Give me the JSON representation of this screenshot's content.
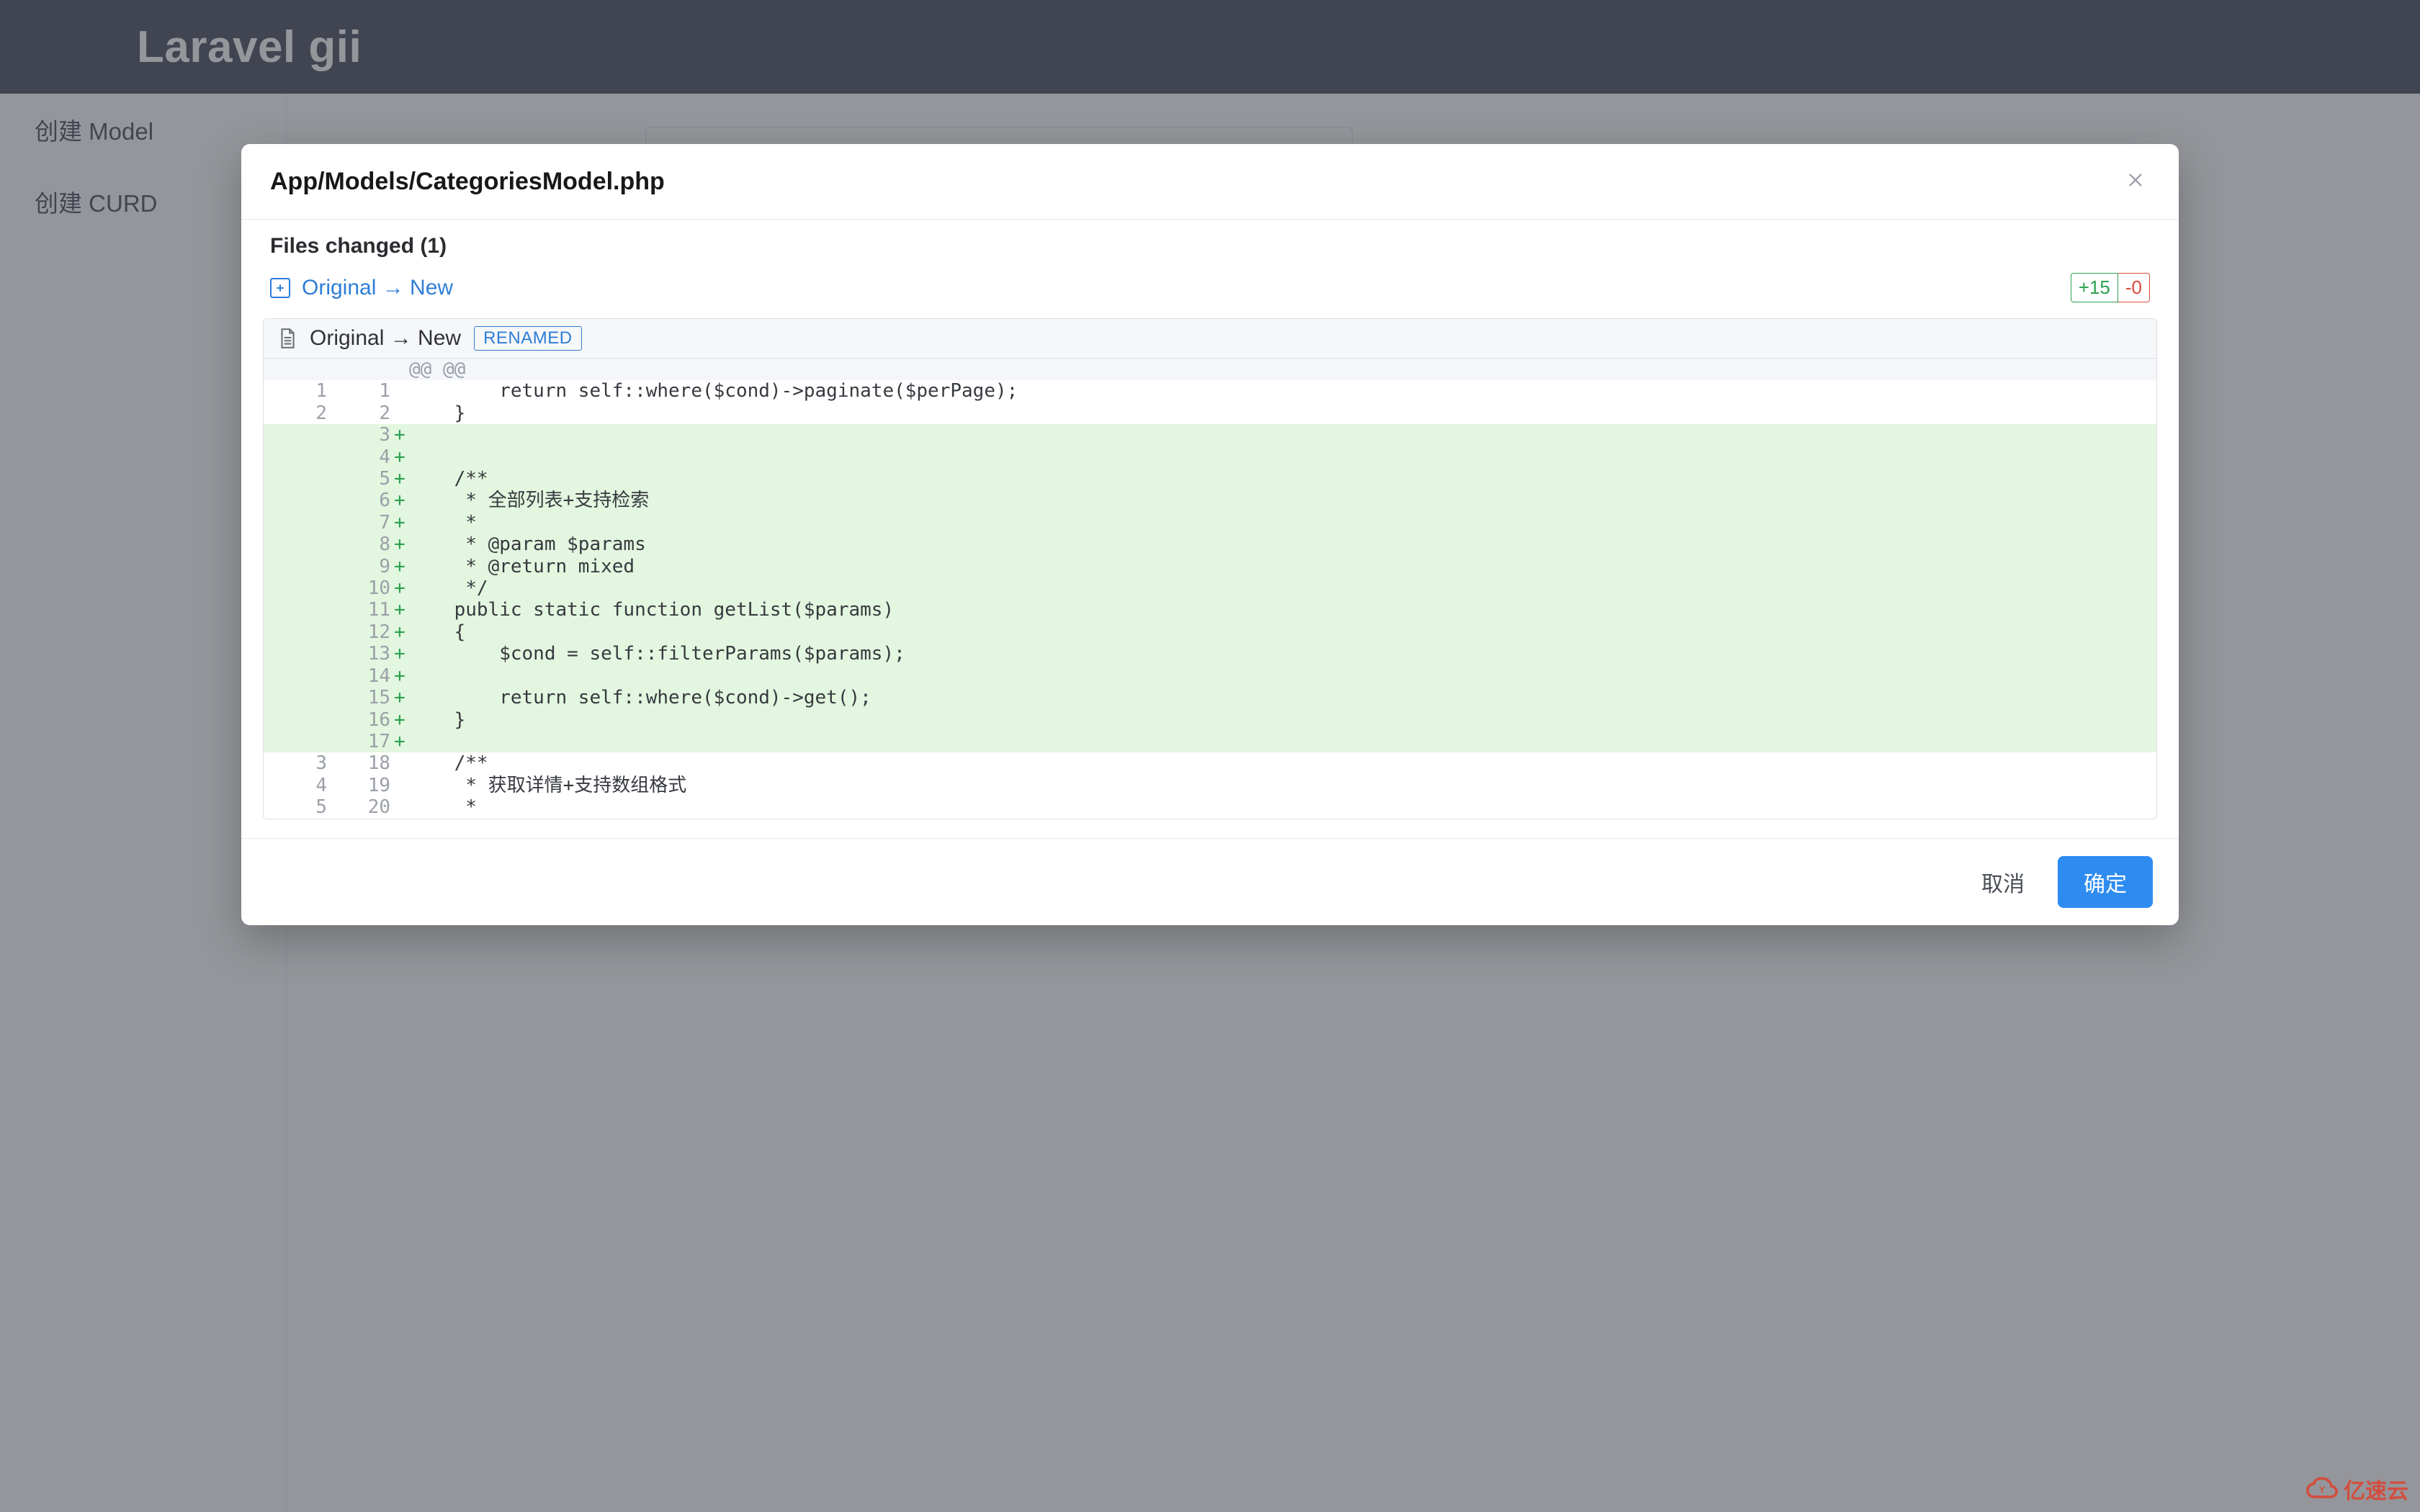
{
  "header": {
    "brand": "Laravel gii"
  },
  "sidebar": {
    "items": [
      {
        "label": "创建 Model"
      },
      {
        "label": "创建 CURD"
      }
    ]
  },
  "modal": {
    "title": "App/Models/CategoriesModel.php",
    "files_changed_label": "Files changed (1)",
    "file_link_label": "Original → New",
    "stats": {
      "additions": "+15",
      "deletions": "-0"
    },
    "diff_header_label": "Original → New",
    "renamed_badge": "RENAMED",
    "footer": {
      "cancel": "取消",
      "confirm": "确定"
    }
  },
  "diff": {
    "hunk_header": "@@ @@",
    "rows": [
      {
        "old": "1",
        "new": "1",
        "marker": " ",
        "code": "        return self::where($cond)->paginate($perPage);",
        "type": "ctx"
      },
      {
        "old": "2",
        "new": "2",
        "marker": " ",
        "code": "    }",
        "type": "ctx"
      },
      {
        "old": "",
        "new": "3",
        "marker": "+",
        "code": "",
        "type": "add"
      },
      {
        "old": "",
        "new": "4",
        "marker": "+",
        "code": "",
        "type": "add"
      },
      {
        "old": "",
        "new": "5",
        "marker": "+",
        "code": "    /**",
        "type": "add"
      },
      {
        "old": "",
        "new": "6",
        "marker": "+",
        "code": "     * 全部列表+支持检索",
        "type": "add"
      },
      {
        "old": "",
        "new": "7",
        "marker": "+",
        "code": "     *",
        "type": "add"
      },
      {
        "old": "",
        "new": "8",
        "marker": "+",
        "code": "     * @param $params",
        "type": "add"
      },
      {
        "old": "",
        "new": "9",
        "marker": "+",
        "code": "     * @return mixed",
        "type": "add"
      },
      {
        "old": "",
        "new": "10",
        "marker": "+",
        "code": "     */",
        "type": "add"
      },
      {
        "old": "",
        "new": "11",
        "marker": "+",
        "code": "    public static function getList($params)",
        "type": "add"
      },
      {
        "old": "",
        "new": "12",
        "marker": "+",
        "code": "    {",
        "type": "add"
      },
      {
        "old": "",
        "new": "13",
        "marker": "+",
        "code": "        $cond = self::filterParams($params);",
        "type": "add"
      },
      {
        "old": "",
        "new": "14",
        "marker": "+",
        "code": "",
        "type": "add"
      },
      {
        "old": "",
        "new": "15",
        "marker": "+",
        "code": "        return self::where($cond)->get();",
        "type": "add"
      },
      {
        "old": "",
        "new": "16",
        "marker": "+",
        "code": "    }",
        "type": "add"
      },
      {
        "old": "",
        "new": "17",
        "marker": "+",
        "code": "",
        "type": "add"
      },
      {
        "old": "3",
        "new": "18",
        "marker": " ",
        "code": "    /**",
        "type": "ctx"
      },
      {
        "old": "4",
        "new": "19",
        "marker": " ",
        "code": "     * 获取详情+支持数组格式",
        "type": "ctx"
      },
      {
        "old": "5",
        "new": "20",
        "marker": " ",
        "code": "     *",
        "type": "ctx"
      }
    ]
  },
  "watermark": {
    "text": "亿速云"
  }
}
